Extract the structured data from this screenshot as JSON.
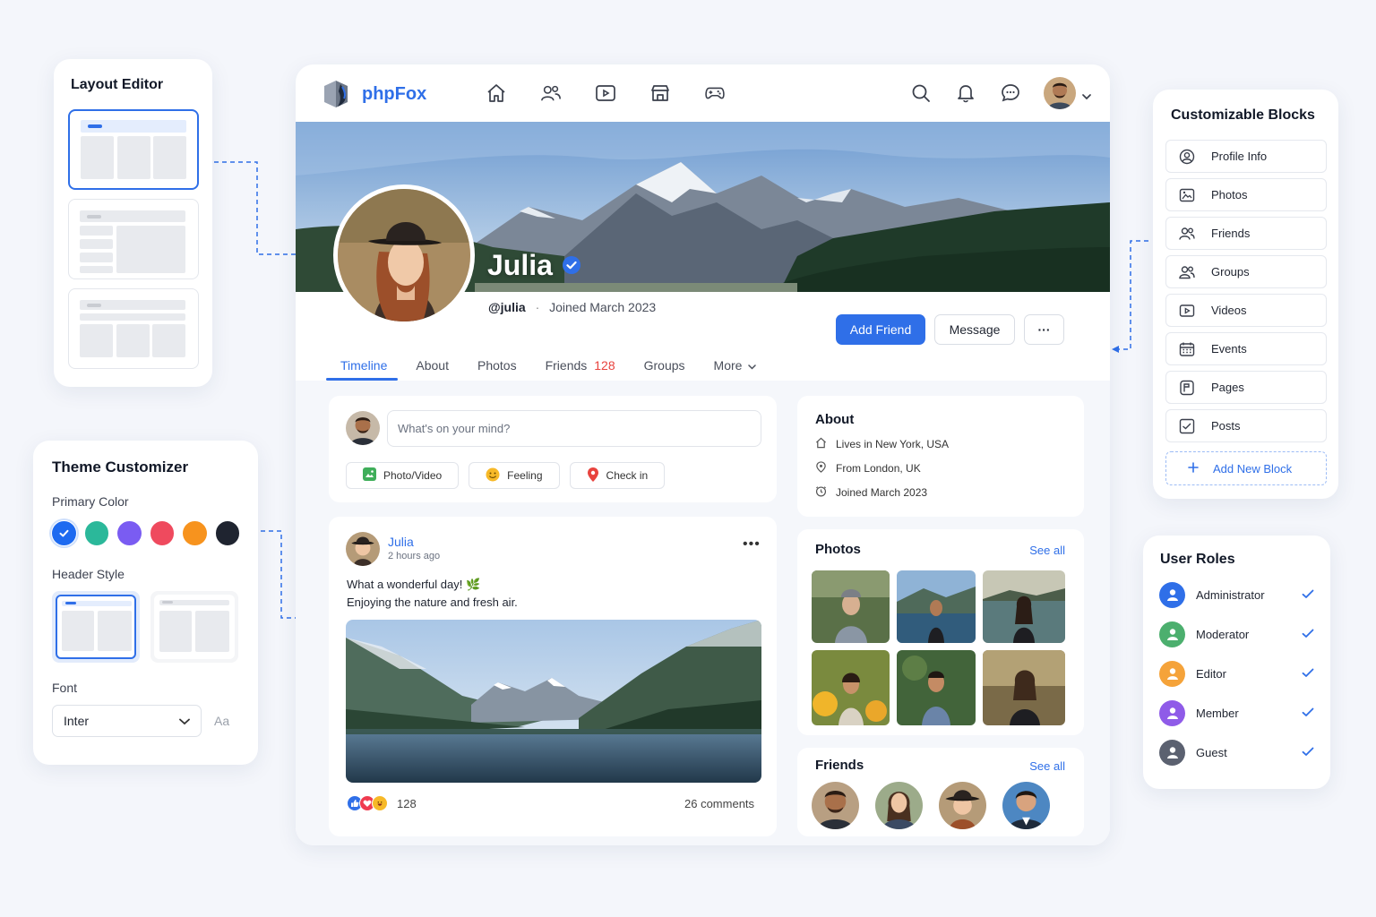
{
  "layout_editor": {
    "title": "Layout Editor"
  },
  "theme_customizer": {
    "title": "Theme Customizer",
    "primary_color_label": "Primary Color",
    "colors": [
      "#1d6af0",
      "#2bb89a",
      "#7a5cf2",
      "#ef4a5e",
      "#f7931e",
      "#1f2430"
    ],
    "selected_color": "#1d6af0",
    "header_style_label": "Header Style",
    "font_label": "Font",
    "font_value": "Inter",
    "font_preview": "Aa"
  },
  "app": {
    "brand": "phpFox",
    "accent": "#2f6fe8",
    "nav_icons": [
      "home-icon",
      "friends-icon",
      "video-icon",
      "marketplace-icon",
      "games-icon"
    ],
    "right_icons": [
      "search-icon",
      "bell-icon",
      "chat-icon"
    ],
    "profile": {
      "name": "Julia",
      "handle": "@julia",
      "separator": "·",
      "joined": "Joined March 2023",
      "add_friend": "Add Friend",
      "message": "Message",
      "more": "···"
    },
    "tabs": [
      {
        "label": "Timeline"
      },
      {
        "label": "About"
      },
      {
        "label": "Photos"
      },
      {
        "label": "Friends",
        "count": "128"
      },
      {
        "label": "Groups"
      },
      {
        "label": "More"
      }
    ],
    "composer": {
      "placeholder": "What's on your mind?",
      "actions": [
        "Photo/Video",
        "Feeling",
        "Check in"
      ]
    },
    "post": {
      "author": "Julia",
      "time": "2 hours ago",
      "line1": "What a wonderful day! 🌿",
      "line2": "Enjoying the nature and fresh air.",
      "reaction_count": "128",
      "comments": "26 comments"
    },
    "about": {
      "title": "About",
      "items": [
        "Lives in New York, USA",
        "From London, UK",
        "Joined March 2023"
      ]
    },
    "photos": {
      "title": "Photos",
      "see_all": "See all"
    },
    "friends": {
      "title": "Friends",
      "see_all": "See all"
    }
  },
  "blocks": {
    "title": "Customizable Blocks",
    "items": [
      "Profile Info",
      "Photos",
      "Friends",
      "Groups",
      "Videos",
      "Events",
      "Pages",
      "Posts"
    ],
    "add_label": "Add New Block"
  },
  "roles": {
    "title": "User Roles",
    "items": [
      {
        "label": "Administrator",
        "color": "#2f6fe8"
      },
      {
        "label": "Moderator",
        "color": "#4caf6e"
      },
      {
        "label": "Editor",
        "color": "#f5a33a"
      },
      {
        "label": "Member",
        "color": "#8f5be8"
      },
      {
        "label": "Guest",
        "color": "#5b6170"
      }
    ]
  }
}
